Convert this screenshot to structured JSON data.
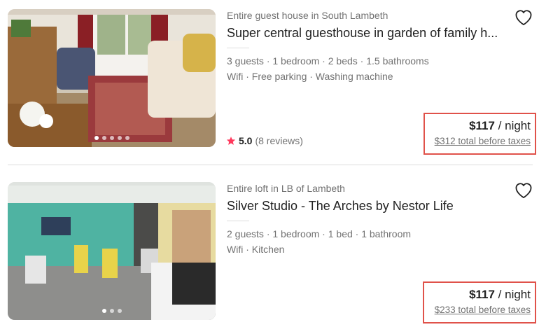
{
  "listings": [
    {
      "subtitle": "Entire guest house in South Lambeth",
      "title": "Super central guesthouse in garden of family h...",
      "details": "3 guests · 1 bedroom · 2 beds · 1.5 bathrooms",
      "amenities": "Wifi · Free parking · Washing machine",
      "rating_score": "5.0",
      "rating_count": "(8 reviews)",
      "price": "$117",
      "price_unit": " / night",
      "total": "$312 total before taxes"
    },
    {
      "subtitle": "Entire loft in LB of Lambeth",
      "title": "Silver Studio - The Arches by Nestor Life",
      "details": "2 guests · 1 bedroom · 1 bed · 1 bathroom",
      "amenities": "Wifi · Kitchen",
      "price": "$117",
      "price_unit": " / night",
      "total": "$233 total before taxes"
    }
  ],
  "colors": {
    "accent_highlight": "#e0524a",
    "star": "#ff385c",
    "text_primary": "#222222",
    "text_secondary": "#717171"
  }
}
